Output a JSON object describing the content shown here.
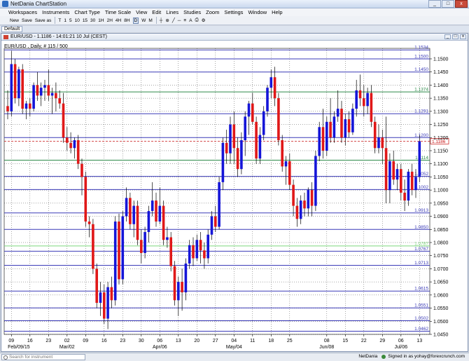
{
  "app": {
    "title": "NetDania ChartStation",
    "window_buttons": [
      "_",
      "□",
      "x"
    ]
  },
  "menu": [
    "Workspaces",
    "Instruments",
    "Chart Type",
    "Time Scale",
    "View",
    "Edit",
    "Lines",
    "Studies",
    "Zoom",
    "Settings",
    "Window",
    "Help"
  ],
  "toolbar": {
    "new_label": "New",
    "save_label": "Save",
    "saveas_label": "Save as",
    "periods": [
      "T",
      "1",
      "5",
      "10",
      "15",
      "30",
      "1H",
      "2H",
      "4H",
      "8H",
      "D",
      "W",
      "M"
    ],
    "active_period": "D"
  },
  "tab": {
    "label": "Default"
  },
  "chart_window": {
    "header": "EUR/USD - 1.1186 - 14:01:21 10 Jul (CEST)",
    "sub_label": "EUR/USD , Daily, # 115 / 500"
  },
  "status": {
    "search_placeholder": "Search for instrument",
    "brand": "NetDania",
    "signed_in": "Signed in as yohay@forexcrunch.com"
  },
  "colors": {
    "up": "#1515d8",
    "down": "#e01818",
    "grid": "#000000",
    "hline": "#3b3bb8",
    "hline_green": "#2e8a4a",
    "hline_lightgreen": "#7cd67c",
    "current_price": "#c81414"
  },
  "chart_data": {
    "type": "candlestick",
    "instrument": "EUR/USD",
    "timeframe": "Daily",
    "ylim": [
      1.045,
      1.154
    ],
    "y_ticks": [
      "1.1500",
      "1.1450",
      "1.1400",
      "1.1350",
      "1.1300",
      "1.1250",
      "1.1200",
      "1.1150",
      "1.1100",
      "1.1050",
      "1.1000",
      "1.0950",
      "1.0900",
      "1.0850",
      "1.0800",
      "1.0750",
      "1.0700",
      "1.0650",
      "1.0600",
      "1.0550",
      "1.0500",
      "1.0450"
    ],
    "x_ticks": [
      {
        "label": "09",
        "idx": 1
      },
      {
        "label": "16",
        "idx": 6
      },
      {
        "label": "23",
        "idx": 11
      },
      {
        "label": "02",
        "idx": 16
      },
      {
        "label": "09",
        "idx": 21
      },
      {
        "label": "16",
        "idx": 26
      },
      {
        "label": "23",
        "idx": 31
      },
      {
        "label": "30",
        "idx": 36
      },
      {
        "label": "06",
        "idx": 41
      },
      {
        "label": "13",
        "idx": 46
      },
      {
        "label": "20",
        "idx": 51
      },
      {
        "label": "27",
        "idx": 56
      },
      {
        "label": "04",
        "idx": 61
      },
      {
        "label": "11",
        "idx": 66
      },
      {
        "label": "18",
        "idx": 71
      },
      {
        "label": "25",
        "idx": 76
      },
      {
        "label": "08",
        "idx": 86
      },
      {
        "label": "15",
        "idx": 91
      },
      {
        "label": "22",
        "idx": 96
      },
      {
        "label": "29",
        "idx": 101
      },
      {
        "label": "06",
        "idx": 106
      },
      {
        "label": "13",
        "idx": 111
      }
    ],
    "x_month_labels": [
      {
        "label": "Feb/09/15",
        "idx": 3
      },
      {
        "label": "Mar/02",
        "idx": 16
      },
      {
        "label": "Apr/06",
        "idx": 41
      },
      {
        "label": "May/04",
        "idx": 61
      },
      {
        "label": "Jun/08",
        "idx": 86
      },
      {
        "label": "Jul/06",
        "idx": 106
      }
    ],
    "current_price": {
      "value": 1.1186,
      "label": "1.1186"
    },
    "horizontal_lines": [
      {
        "value": 1.1534,
        "label": "1.1534",
        "style": "blue"
      },
      {
        "value": 1.15,
        "label": "1.1500",
        "style": "blue"
      },
      {
        "value": 1.145,
        "label": "1.1450",
        "style": "blue"
      },
      {
        "value": 1.1374,
        "label": "1.1374",
        "style": "green"
      },
      {
        "value": 1.1291,
        "label": "1.1291",
        "style": "blue"
      },
      {
        "value": 1.12,
        "label": "1.1200",
        "style": "blue"
      },
      {
        "value": 1.1114,
        "label": "1.1114",
        "style": "green"
      },
      {
        "value": 1.1052,
        "label": "1.1052",
        "style": "blue"
      },
      {
        "value": 1.1002,
        "label": "1.1002",
        "style": "blue"
      },
      {
        "value": 1.0913,
        "label": "1.0913",
        "style": "blue"
      },
      {
        "value": 1.085,
        "label": "1.0850",
        "style": "blue"
      },
      {
        "value": 1.0787,
        "label": "1.0787",
        "style": "lightgreen"
      },
      {
        "value": 1.0767,
        "label": "1.0767",
        "style": "blue"
      },
      {
        "value": 1.0713,
        "label": "1.0713",
        "style": "blue"
      },
      {
        "value": 1.0615,
        "label": "1.0615",
        "style": "blue"
      },
      {
        "value": 1.0551,
        "label": "1.0551",
        "style": "blue"
      },
      {
        "value": 1.0502,
        "label": "1.0502",
        "style": "blue"
      },
      {
        "value": 1.0462,
        "label": "1.0462",
        "style": "blue"
      }
    ],
    "candles": [
      [
        1.132,
        1.138,
        1.127,
        1.13
      ],
      [
        1.13,
        1.153,
        1.128,
        1.148
      ],
      [
        1.148,
        1.15,
        1.133,
        1.135
      ],
      [
        1.135,
        1.147,
        1.132,
        1.146
      ],
      [
        1.146,
        1.148,
        1.129,
        1.131
      ],
      [
        1.131,
        1.134,
        1.127,
        1.133
      ],
      [
        1.133,
        1.135,
        1.128,
        1.131
      ],
      [
        1.131,
        1.141,
        1.13,
        1.14
      ],
      [
        1.14,
        1.145,
        1.134,
        1.136
      ],
      [
        1.136,
        1.141,
        1.132,
        1.139
      ],
      [
        1.139,
        1.142,
        1.134,
        1.14
      ],
      [
        1.14,
        1.146,
        1.134,
        1.136
      ],
      [
        1.136,
        1.139,
        1.129,
        1.137
      ],
      [
        1.137,
        1.141,
        1.13,
        1.135
      ],
      [
        1.135,
        1.138,
        1.131,
        1.133
      ],
      [
        1.133,
        1.137,
        1.118,
        1.12
      ],
      [
        1.12,
        1.124,
        1.115,
        1.118
      ],
      [
        1.118,
        1.122,
        1.114,
        1.116
      ],
      [
        1.116,
        1.12,
        1.112,
        1.119
      ],
      [
        1.119,
        1.121,
        1.108,
        1.11
      ],
      [
        1.11,
        1.112,
        1.098,
        1.105
      ],
      [
        1.105,
        1.107,
        1.086,
        1.088
      ],
      [
        1.088,
        1.09,
        1.082,
        1.087
      ],
      [
        1.087,
        1.089,
        1.068,
        1.07
      ],
      [
        1.07,
        1.072,
        1.055,
        1.057
      ],
      [
        1.057,
        1.065,
        1.052,
        1.061
      ],
      [
        1.061,
        1.064,
        1.049,
        1.051
      ],
      [
        1.051,
        1.065,
        1.047,
        1.063
      ],
      [
        1.063,
        1.067,
        1.055,
        1.058
      ],
      [
        1.058,
        1.09,
        1.056,
        1.088
      ],
      [
        1.088,
        1.091,
        1.064,
        1.066
      ],
      [
        1.066,
        1.092,
        1.064,
        1.09
      ],
      [
        1.09,
        1.101,
        1.088,
        1.097
      ],
      [
        1.097,
        1.099,
        1.085,
        1.087
      ],
      [
        1.087,
        1.096,
        1.082,
        1.094
      ],
      [
        1.094,
        1.096,
        1.079,
        1.081
      ],
      [
        1.081,
        1.085,
        1.072,
        1.076
      ],
      [
        1.076,
        1.086,
        1.074,
        1.084
      ],
      [
        1.084,
        1.094,
        1.08,
        1.092
      ],
      [
        1.092,
        1.103,
        1.09,
        1.096
      ],
      [
        1.096,
        1.099,
        1.086,
        1.088
      ],
      [
        1.088,
        1.101,
        1.087,
        1.094
      ],
      [
        1.094,
        1.096,
        1.079,
        1.081
      ],
      [
        1.081,
        1.086,
        1.078,
        1.082
      ],
      [
        1.082,
        1.084,
        1.069,
        1.071
      ],
      [
        1.071,
        1.073,
        1.056,
        1.058
      ],
      [
        1.058,
        1.067,
        1.052,
        1.065
      ],
      [
        1.065,
        1.07,
        1.054,
        1.061
      ],
      [
        1.061,
        1.074,
        1.058,
        1.072
      ],
      [
        1.072,
        1.081,
        1.07,
        1.079
      ],
      [
        1.079,
        1.082,
        1.071,
        1.074
      ],
      [
        1.074,
        1.083,
        1.073,
        1.081
      ],
      [
        1.081,
        1.084,
        1.072,
        1.077
      ],
      [
        1.077,
        1.08,
        1.07,
        1.074
      ],
      [
        1.074,
        1.085,
        1.072,
        1.083
      ],
      [
        1.083,
        1.092,
        1.081,
        1.09
      ],
      [
        1.09,
        1.094,
        1.084,
        1.086
      ],
      [
        1.086,
        1.105,
        1.085,
        1.103
      ],
      [
        1.103,
        1.12,
        1.1,
        1.118
      ],
      [
        1.118,
        1.123,
        1.11,
        1.114
      ],
      [
        1.114,
        1.128,
        1.11,
        1.125
      ],
      [
        1.125,
        1.13,
        1.11,
        1.116
      ],
      [
        1.116,
        1.12,
        1.105,
        1.108
      ],
      [
        1.108,
        1.122,
        1.106,
        1.119
      ],
      [
        1.119,
        1.13,
        1.113,
        1.128
      ],
      [
        1.128,
        1.134,
        1.121,
        1.133
      ],
      [
        1.133,
        1.137,
        1.125,
        1.126
      ],
      [
        1.126,
        1.128,
        1.11,
        1.112
      ],
      [
        1.112,
        1.124,
        1.11,
        1.121
      ],
      [
        1.121,
        1.132,
        1.119,
        1.13
      ],
      [
        1.13,
        1.14,
        1.128,
        1.139
      ],
      [
        1.139,
        1.146,
        1.135,
        1.143
      ],
      [
        1.143,
        1.147,
        1.132,
        1.135
      ],
      [
        1.135,
        1.137,
        1.117,
        1.119
      ],
      [
        1.119,
        1.121,
        1.107,
        1.109
      ],
      [
        1.109,
        1.113,
        1.102,
        1.111
      ],
      [
        1.111,
        1.114,
        1.1,
        1.102
      ],
      [
        1.102,
        1.104,
        1.09,
        1.094
      ],
      [
        1.094,
        1.097,
        1.086,
        1.089
      ],
      [
        1.089,
        1.098,
        1.087,
        1.096
      ],
      [
        1.096,
        1.099,
        1.09,
        1.093
      ],
      [
        1.093,
        1.101,
        1.09,
        1.1
      ],
      [
        1.1,
        1.103,
        1.09,
        1.094
      ],
      [
        1.094,
        1.115,
        1.092,
        1.113
      ],
      [
        1.113,
        1.126,
        1.111,
        1.124
      ],
      [
        1.124,
        1.131,
        1.112,
        1.115
      ],
      [
        1.115,
        1.128,
        1.113,
        1.126
      ],
      [
        1.126,
        1.135,
        1.118,
        1.12
      ],
      [
        1.12,
        1.13,
        1.118,
        1.128
      ],
      [
        1.128,
        1.138,
        1.126,
        1.131
      ],
      [
        1.131,
        1.134,
        1.118,
        1.12
      ],
      [
        1.12,
        1.129,
        1.117,
        1.127
      ],
      [
        1.127,
        1.13,
        1.12,
        1.122
      ],
      [
        1.122,
        1.133,
        1.121,
        1.131
      ],
      [
        1.131,
        1.142,
        1.128,
        1.138
      ],
      [
        1.138,
        1.144,
        1.132,
        1.135
      ],
      [
        1.135,
        1.14,
        1.128,
        1.132
      ],
      [
        1.132,
        1.139,
        1.129,
        1.137
      ],
      [
        1.137,
        1.14,
        1.124,
        1.126
      ],
      [
        1.126,
        1.128,
        1.114,
        1.116
      ],
      [
        1.116,
        1.125,
        1.114,
        1.12
      ],
      [
        1.12,
        1.123,
        1.11,
        1.116
      ],
      [
        1.116,
        1.128,
        1.095,
        1.1
      ],
      [
        1.1,
        1.114,
        1.095,
        1.111
      ],
      [
        1.111,
        1.115,
        1.102,
        1.104
      ],
      [
        1.104,
        1.11,
        1.1,
        1.108
      ],
      [
        1.108,
        1.11,
        1.096,
        1.099
      ],
      [
        1.099,
        1.104,
        1.092,
        1.096
      ],
      [
        1.096,
        1.108,
        1.094,
        1.107
      ],
      [
        1.107,
        1.11,
        1.098,
        1.1
      ],
      [
        1.1,
        1.108,
        1.097,
        1.105
      ],
      [
        1.105,
        1.121,
        1.103,
        1.1186
      ]
    ]
  }
}
